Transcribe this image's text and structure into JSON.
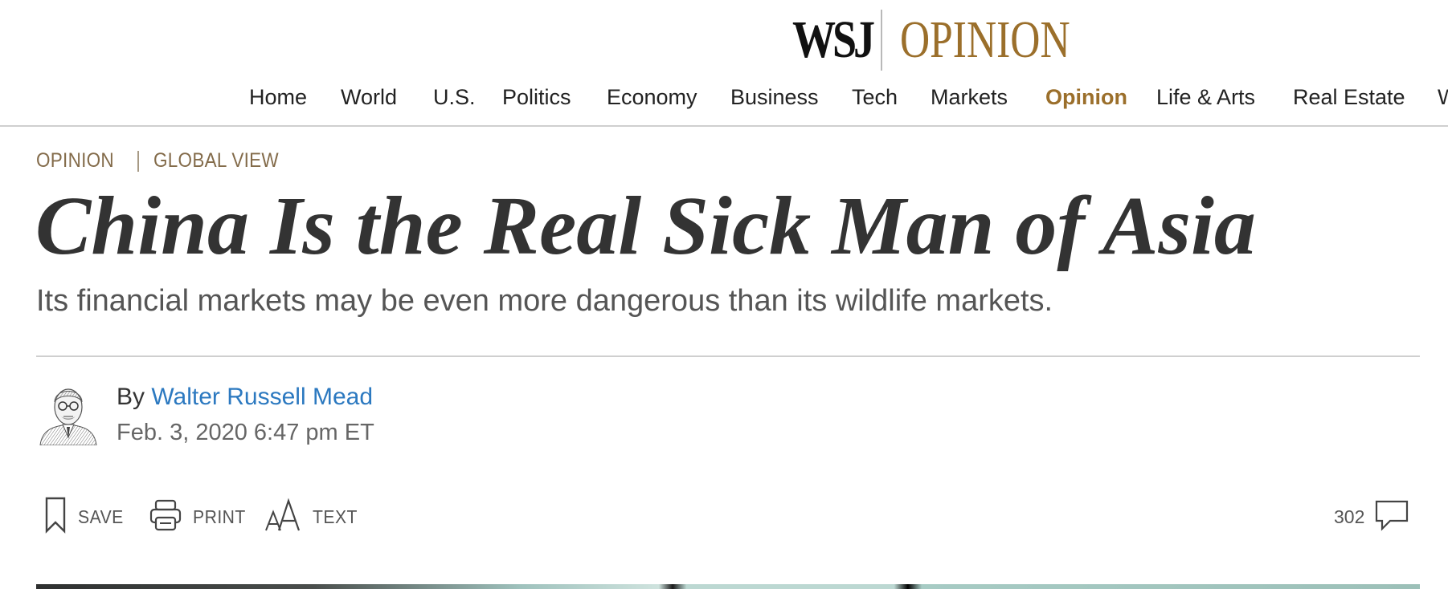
{
  "masthead": {
    "logo_wsj": "WSJ",
    "logo_section": "OPINION"
  },
  "nav": {
    "items": [
      "Home",
      "World",
      "U.S.",
      "Politics",
      "Economy",
      "Business",
      "Tech",
      "Markets",
      "Opinion",
      "Life & Arts",
      "Real Estate",
      "W"
    ],
    "active": "Opinion"
  },
  "article": {
    "section": "OPINION",
    "column": "GLOBAL VIEW",
    "headline": "China Is the Real Sick Man of Asia",
    "dek": "Its financial markets may be even more dangerous than its wildlife markets.",
    "byline_prefix": "By",
    "author": "Walter Russell Mead",
    "timestamp": "Feb. 3, 2020 6:47 pm ET"
  },
  "tools": {
    "save_label": "SAVE",
    "print_label": "PRINT",
    "text_label": "TEXT",
    "comment_count": "302"
  },
  "icons": {
    "save": "bookmark-icon",
    "print": "printer-icon",
    "text": "text-size-icon",
    "comments": "speech-bubble-icon"
  },
  "colors": {
    "accent": "#9b6f2b",
    "section": "#836b4a",
    "link": "#2c79c0"
  }
}
